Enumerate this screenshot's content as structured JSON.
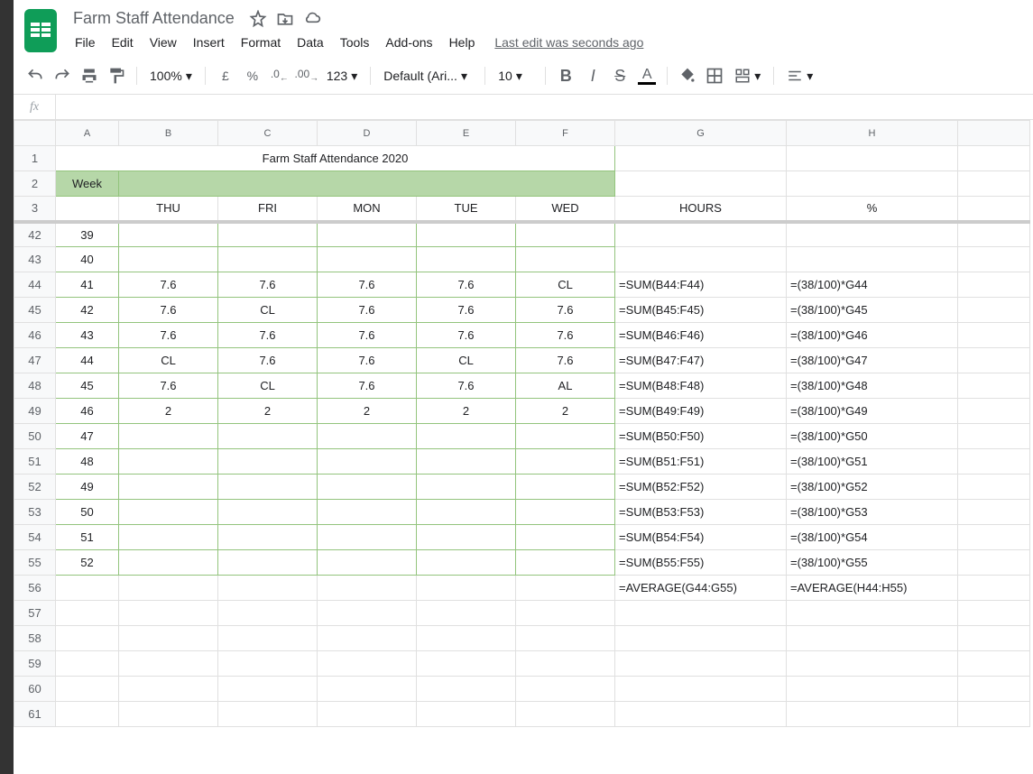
{
  "doc": {
    "title": "Farm Staff Attendance"
  },
  "menu": {
    "file": "File",
    "edit": "Edit",
    "view": "View",
    "insert": "Insert",
    "format": "Format",
    "data": "Data",
    "tools": "Tools",
    "addons": "Add-ons",
    "help": "Help",
    "last_edit": "Last edit was seconds ago"
  },
  "toolbar": {
    "zoom": "100%",
    "currency": "£",
    "percent": "%",
    "dec_dec": ".0",
    "dec_inc": ".00",
    "more_fmt": "123",
    "font_name": "Default (Ari...",
    "font_size": "10"
  },
  "fx": {
    "label": "fx",
    "value": ""
  },
  "chart_data": {
    "type": "table",
    "title": "Farm Staff Attendance 2020",
    "week_label": "Week",
    "columns": [
      "A",
      "B",
      "C",
      "D",
      "E",
      "F",
      "G",
      "H"
    ],
    "headers": {
      "b": "THU",
      "c": "FRI",
      "d": "MON",
      "e": "TUE",
      "f": "WED",
      "g": "HOURS",
      "h": "%"
    },
    "rows": [
      {
        "rn": "42",
        "a": "39",
        "b": "",
        "c": "",
        "d": "",
        "e": "",
        "f": "",
        "g": "",
        "h": ""
      },
      {
        "rn": "43",
        "a": "40",
        "b": "",
        "c": "",
        "d": "",
        "e": "",
        "f": "",
        "g": "",
        "h": ""
      },
      {
        "rn": "44",
        "a": "41",
        "b": "7.6",
        "c": "7.6",
        "d": "7.6",
        "e": "7.6",
        "f": "CL",
        "g": "=SUM(B44:F44)",
        "h": "=(38/100)*G44"
      },
      {
        "rn": "45",
        "a": "42",
        "b": "7.6",
        "c": "CL",
        "d": "7.6",
        "e": "7.6",
        "f": "7.6",
        "g": "=SUM(B45:F45)",
        "h": "=(38/100)*G45"
      },
      {
        "rn": "46",
        "a": "43",
        "b": "7.6",
        "c": "7.6",
        "d": "7.6",
        "e": "7.6",
        "f": "7.6",
        "g": "=SUM(B46:F46)",
        "h": "=(38/100)*G46"
      },
      {
        "rn": "47",
        "a": "44",
        "b": "CL",
        "c": "7.6",
        "d": "7.6",
        "e": "CL",
        "f": "7.6",
        "g": "=SUM(B47:F47)",
        "h": "=(38/100)*G47"
      },
      {
        "rn": "48",
        "a": "45",
        "b": "7.6",
        "c": "CL",
        "d": "7.6",
        "e": "7.6",
        "f": "AL",
        "g": "=SUM(B48:F48)",
        "h": "=(38/100)*G48"
      },
      {
        "rn": "49",
        "a": "46",
        "b": "2",
        "c": "2",
        "d": "2",
        "e": "2",
        "f": "2",
        "g": "=SUM(B49:F49)",
        "h": "=(38/100)*G49"
      },
      {
        "rn": "50",
        "a": "47",
        "b": "",
        "c": "",
        "d": "",
        "e": "",
        "f": "",
        "g": "=SUM(B50:F50)",
        "h": "=(38/100)*G50"
      },
      {
        "rn": "51",
        "a": "48",
        "b": "",
        "c": "",
        "d": "",
        "e": "",
        "f": "",
        "g": "=SUM(B51:F51)",
        "h": "=(38/100)*G51"
      },
      {
        "rn": "52",
        "a": "49",
        "b": "",
        "c": "",
        "d": "",
        "e": "",
        "f": "",
        "g": "=SUM(B52:F52)",
        "h": "=(38/100)*G52"
      },
      {
        "rn": "53",
        "a": "50",
        "b": "",
        "c": "",
        "d": "",
        "e": "",
        "f": "",
        "g": "=SUM(B53:F53)",
        "h": "=(38/100)*G53"
      },
      {
        "rn": "54",
        "a": "51",
        "b": "",
        "c": "",
        "d": "",
        "e": "",
        "f": "",
        "g": "=SUM(B54:F54)",
        "h": "=(38/100)*G54"
      },
      {
        "rn": "55",
        "a": "52",
        "b": "",
        "c": "",
        "d": "",
        "e": "",
        "f": "",
        "g": "=SUM(B55:F55)",
        "h": "=(38/100)*G55"
      },
      {
        "rn": "56",
        "a": "",
        "b": "",
        "c": "",
        "d": "",
        "e": "",
        "f": "",
        "g": "=AVERAGE(G44:G55)",
        "h": "=AVERAGE(H44:H55)"
      },
      {
        "rn": "57",
        "a": "",
        "b": "",
        "c": "",
        "d": "",
        "e": "",
        "f": "",
        "g": "",
        "h": ""
      },
      {
        "rn": "58",
        "a": "",
        "b": "",
        "c": "",
        "d": "",
        "e": "",
        "f": "",
        "g": "",
        "h": ""
      },
      {
        "rn": "59",
        "a": "",
        "b": "",
        "c": "",
        "d": "",
        "e": "",
        "f": "",
        "g": "",
        "h": ""
      },
      {
        "rn": "60",
        "a": "",
        "b": "",
        "c": "",
        "d": "",
        "e": "",
        "f": "",
        "g": "",
        "h": ""
      },
      {
        "rn": "61",
        "a": "",
        "b": "",
        "c": "",
        "d": "",
        "e": "",
        "f": "",
        "g": "",
        "h": ""
      }
    ]
  }
}
